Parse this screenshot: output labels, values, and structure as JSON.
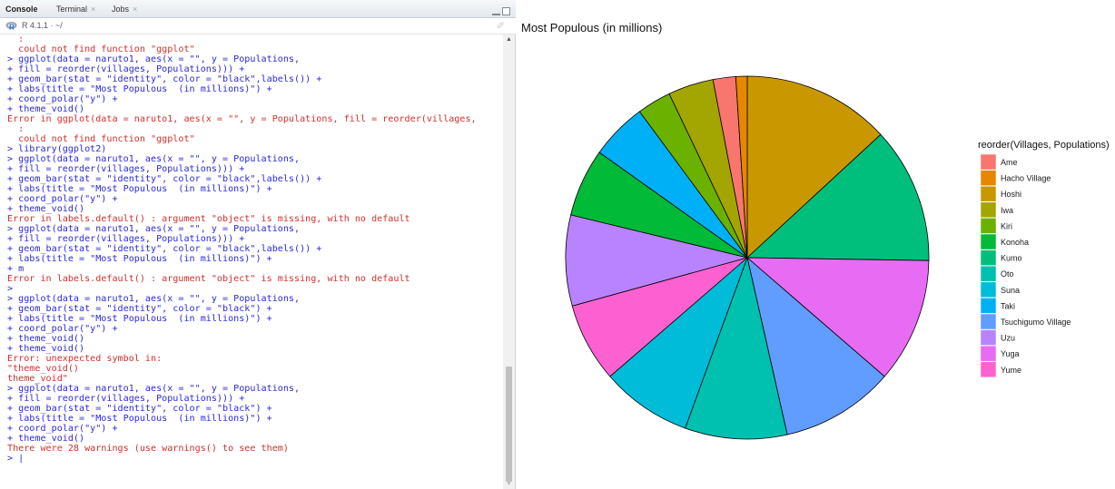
{
  "tabs": [
    {
      "label": "Console",
      "active": true,
      "closable": false
    },
    {
      "label": "Terminal",
      "active": false,
      "closable": true
    },
    {
      "label": "Jobs",
      "active": false,
      "closable": true
    }
  ],
  "path": {
    "r_version": "R 4.1.1 · ~/"
  },
  "console_lines": [
    {
      "t": "err",
      "text": "  :"
    },
    {
      "t": "err",
      "text": "  could not find function \"ggplot\""
    },
    {
      "t": "cmd",
      "text": "> ggplot(data = naruto1, aes(x = \"\", y = Populations,"
    },
    {
      "t": "cmd",
      "text": "+ fill = reorder(villages, Populations))) +"
    },
    {
      "t": "cmd",
      "text": "+ geom_bar(stat = \"identity\", color = \"black\",labels()) +"
    },
    {
      "t": "cmd",
      "text": "+ labs(title = \"Most Populous  (in millions)\") +"
    },
    {
      "t": "cmd",
      "text": "+ coord_polar(\"y\") +"
    },
    {
      "t": "cmd",
      "text": "+ theme_void()"
    },
    {
      "t": "err",
      "text": "Error in ggplot(data = naruto1, aes(x = \"\", y = Populations, fill = reorder(villages,"
    },
    {
      "t": "err",
      "text": "  :"
    },
    {
      "t": "err",
      "text": "  could not find function \"ggplot\""
    },
    {
      "t": "cmd",
      "text": "> library(ggplot2)"
    },
    {
      "t": "cmd",
      "text": "> ggplot(data = naruto1, aes(x = \"\", y = Populations,"
    },
    {
      "t": "cmd",
      "text": "+ fill = reorder(villages, Populations))) +"
    },
    {
      "t": "cmd",
      "text": "+ geom_bar(stat = \"identity\", color = \"black\",labels()) +"
    },
    {
      "t": "cmd",
      "text": "+ labs(title = \"Most Populous  (in millions)\") +"
    },
    {
      "t": "cmd",
      "text": "+ coord_polar(\"y\") +"
    },
    {
      "t": "cmd",
      "text": "+ theme_void()"
    },
    {
      "t": "err",
      "text": "Error in labels.default() : argument \"object\" is missing, with no default"
    },
    {
      "t": "cmd",
      "text": "> ggplot(data = naruto1, aes(x = \"\", y = Populations,"
    },
    {
      "t": "cmd",
      "text": "+ fill = reorder(villages, Populations))) +"
    },
    {
      "t": "cmd",
      "text": "+ geom_bar(stat = \"identity\", color = \"black\",labels()) +"
    },
    {
      "t": "cmd",
      "text": "+ labs(title = \"Most Populous  (in millions)\") +"
    },
    {
      "t": "cmd",
      "text": "+ m"
    },
    {
      "t": "err",
      "text": "Error in labels.default() : argument \"object\" is missing, with no default"
    },
    {
      "t": "cmd",
      "text": ">"
    },
    {
      "t": "cmd",
      "text": "> ggplot(data = naruto1, aes(x = \"\", y = Populations,"
    },
    {
      "t": "cmd",
      "text": "+ geom_bar(stat = \"identity\", color = \"black\") +"
    },
    {
      "t": "cmd",
      "text": "+ labs(title = \"Most Populous  (in millions)\") +"
    },
    {
      "t": "cmd",
      "text": "+ coord_polar(\"y\") +"
    },
    {
      "t": "cmd",
      "text": "+ theme_void()"
    },
    {
      "t": "cmd",
      "text": "+ theme_void()"
    },
    {
      "t": "err",
      "text": "Error: unexpected symbol in:"
    },
    {
      "t": "err",
      "text": "\"theme_void()"
    },
    {
      "t": "err",
      "text": "theme_void\""
    },
    {
      "t": "cmd",
      "text": "> ggplot(data = naruto1, aes(x = \"\", y = Populations,"
    },
    {
      "t": "cmd",
      "text": "+ fill = reorder(villages, Populations))) +"
    },
    {
      "t": "cmd",
      "text": "+ geom_bar(stat = \"identity\", color = \"black\") +"
    },
    {
      "t": "cmd",
      "text": "+ labs(title = \"Most Populous  (in millions)\") +"
    },
    {
      "t": "cmd",
      "text": "+ coord_polar(\"y\") +"
    },
    {
      "t": "cmd",
      "text": "+ theme_void()"
    },
    {
      "t": "err",
      "text": "There were 28 warnings (use warnings() to see them)"
    },
    {
      "t": "prompt",
      "text": "> |"
    }
  ],
  "chart_data": {
    "type": "pie",
    "title": "Most Populous  (in millions)",
    "legend_title": "reorder(Villages, Populations)",
    "legend_position": "right",
    "categories": [
      "Ame",
      "Hacho Village",
      "Hoshi",
      "Iwa",
      "Kiri",
      "Konoha",
      "Kumo",
      "Oto",
      "Suna",
      "Taki",
      "Tsuchigumo Village",
      "Uzu",
      "Yuga",
      "Yume"
    ],
    "values": [
      2,
      1,
      13,
      4,
      3,
      6,
      12,
      9,
      8,
      5,
      10,
      8,
      11,
      7
    ],
    "colors": [
      "#F8766D",
      "#E58700",
      "#C99800",
      "#A3A500",
      "#6BB100",
      "#00BA38",
      "#00BF7D",
      "#00C0AF",
      "#00BCD8",
      "#00B0F6",
      "#619CFF",
      "#B983FF",
      "#E76BF3",
      "#FD61D1"
    ],
    "slice_order_clockwise_from_top": [
      "Hoshi",
      "Kumo",
      "Yuga",
      "Tsuchigumo Village",
      "Oto",
      "Suna",
      "Yume",
      "Uzu",
      "Konoha",
      "Taki",
      "Kiri",
      "Iwa",
      "Ame",
      "Hacho Village"
    ]
  }
}
